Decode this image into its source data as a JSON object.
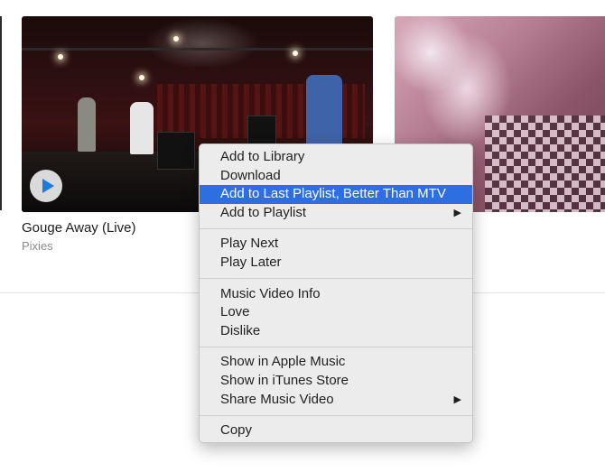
{
  "video": {
    "title": "Gouge Away (Live)",
    "artist": "Pixies",
    "play_icon": "play-icon"
  },
  "context_menu": {
    "highlight_color": "#2d6fe0",
    "groups": [
      [
        {
          "label": "Add to Library"
        },
        {
          "label": "Download"
        },
        {
          "label": "Add to Last Playlist, Better Than MTV",
          "highlighted": true
        },
        {
          "label": "Add to Playlist",
          "submenu": true
        }
      ],
      [
        {
          "label": "Play Next"
        },
        {
          "label": "Play Later"
        }
      ],
      [
        {
          "label": "Music Video Info"
        },
        {
          "label": "Love"
        },
        {
          "label": "Dislike"
        }
      ],
      [
        {
          "label": "Show in Apple Music"
        },
        {
          "label": "Show in iTunes Store"
        },
        {
          "label": "Share Music Video",
          "submenu": true
        }
      ],
      [
        {
          "label": "Copy"
        }
      ]
    ],
    "submenu_glyph": "▶"
  }
}
